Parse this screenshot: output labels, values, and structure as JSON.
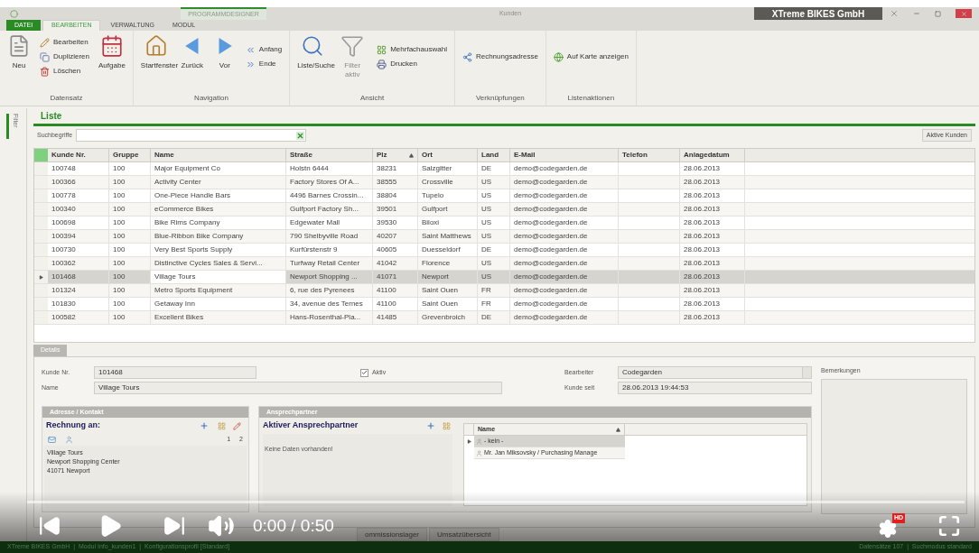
{
  "title_bar": {
    "contextual_tab": "PROGRAMMDESIGNER",
    "title": "Kunden",
    "company": "XTreme BIKES GmbH"
  },
  "ribbon_tabs": [
    {
      "label": "DATEI",
      "kind": "file",
      "selected": false
    },
    {
      "label": "BEARBEITEN",
      "kind": "tab",
      "selected": true
    },
    {
      "label": "VERWALTUNG",
      "kind": "tab",
      "selected": false
    },
    {
      "label": "MODUL",
      "kind": "tab",
      "selected": false
    }
  ],
  "ribbon_groups": [
    {
      "label": "Datensatz",
      "columns": [
        [
          {
            "label": "Neu",
            "kind": "large",
            "disabled": false
          }
        ],
        [
          {
            "label": "Bearbeiten",
            "kind": "small",
            "disabled": false
          },
          {
            "label": "Duplizieren",
            "kind": "small",
            "disabled": false
          },
          {
            "label": "Löschen",
            "kind": "small",
            "disabled": false
          }
        ],
        [
          {
            "label": "Aufgabe",
            "kind": "large",
            "disabled": false
          }
        ]
      ]
    },
    {
      "label": "Navigation",
      "columns": [
        [
          {
            "label": "Startfenster",
            "kind": "large",
            "disabled": false
          }
        ],
        [
          {
            "label": "Zurück",
            "kind": "large",
            "disabled": false
          }
        ],
        [
          {
            "label": "Vor",
            "kind": "large",
            "disabled": false
          }
        ],
        [
          {
            "label": "Anfang",
            "kind": "small",
            "disabled": false
          },
          {
            "label": "Ende",
            "kind": "small",
            "disabled": false
          }
        ]
      ]
    },
    {
      "label": "Ansicht",
      "columns": [
        [
          {
            "label": "Liste/Suche",
            "kind": "large",
            "disabled": false
          }
        ],
        [
          {
            "label": "Filter aktiv",
            "kind": "large",
            "disabled": true
          }
        ],
        [
          {
            "label": "Mehrfachauswahl",
            "kind": "small",
            "disabled": false
          },
          {
            "label": "Drucken",
            "kind": "small",
            "disabled": false
          }
        ]
      ]
    },
    {
      "label": "Verknüpfungen",
      "columns": [
        [
          {
            "label": "Rechnungsadresse",
            "kind": "small",
            "disabled": false
          }
        ]
      ]
    },
    {
      "label": "Listenaktionen",
      "columns": [
        [
          {
            "label": "Auf Karte anzeigen",
            "kind": "small",
            "disabled": false
          }
        ]
      ]
    }
  ],
  "side_panel": {
    "label": "Filter"
  },
  "list": {
    "title": "Liste",
    "search_label": "Suchbegriffe",
    "filter_button": "Aktive Kunden",
    "columns": [
      {
        "label": "Kunde Nr.",
        "sorted": false
      },
      {
        "label": "Gruppe",
        "sorted": false
      },
      {
        "label": "Name",
        "sorted": false
      },
      {
        "label": "Straße",
        "sorted": false
      },
      {
        "label": "Plz",
        "sorted": true
      },
      {
        "label": "Ort",
        "sorted": false
      },
      {
        "label": "Land",
        "sorted": false
      },
      {
        "label": "E-Mail",
        "sorted": false
      },
      {
        "label": "Telefon",
        "sorted": false
      },
      {
        "label": "Anlagedatum",
        "sorted": false
      }
    ],
    "rows": [
      {
        "selected": false,
        "cells": [
          "100748",
          "100",
          "Major Equipment Co",
          "Holstn 6444",
          "38231",
          "Salzgitter",
          "DE",
          "demo@codegarden.de",
          "",
          "28.06.2013"
        ]
      },
      {
        "selected": false,
        "cells": [
          "100366",
          "100",
          "Activity Center",
          "Factory Stores Of A...",
          "38555",
          "Crossville",
          "US",
          "demo@codegarden.de",
          "",
          "28.06.2013"
        ]
      },
      {
        "selected": false,
        "cells": [
          "100778",
          "100",
          "One-Piece Handle Bars",
          "4496 Barnes Crossin...",
          "38804",
          "Tupelo",
          "US",
          "demo@codegarden.de",
          "",
          "28.06.2013"
        ]
      },
      {
        "selected": false,
        "cells": [
          "100340",
          "100",
          "eCommerce Bikes",
          "Gulfport Factory Sh...",
          "39501",
          "Gulfport",
          "US",
          "demo@codegarden.de",
          "",
          "28.06.2013"
        ]
      },
      {
        "selected": false,
        "cells": [
          "100698",
          "100",
          "Bike Rims Company",
          "Edgewater Mall",
          "39530",
          "Biloxi",
          "US",
          "demo@codegarden.de",
          "",
          "28.06.2013"
        ]
      },
      {
        "selected": false,
        "cells": [
          "100394",
          "100",
          "Blue-Ribbon Bike Company",
          "790 Shelbyville Road",
          "40207",
          "Saint Matthews",
          "US",
          "demo@codegarden.de",
          "",
          "28.06.2013"
        ]
      },
      {
        "selected": false,
        "cells": [
          "100730",
          "100",
          "Very Best Sports Supply",
          "Kurfürstenstr 9",
          "40605",
          "Duesseldorf",
          "DE",
          "demo@codegarden.de",
          "",
          "28.06.2013"
        ]
      },
      {
        "selected": false,
        "cells": [
          "100362",
          "100",
          "Distinctive Cycles Sales & Servi...",
          "Turfway Retail Center",
          "41042",
          "Florence",
          "US",
          "demo@codegarden.de",
          "",
          "28.06.2013"
        ]
      },
      {
        "selected": true,
        "cells": [
          "101468",
          "100",
          "Village Tours",
          "Newport Shopping ...",
          "41071",
          "Newport",
          "US",
          "demo@codegarden.de",
          "",
          "28.06.2013"
        ]
      },
      {
        "selected": false,
        "cells": [
          "101324",
          "100",
          "Metro Sports Equipment",
          "6, rue des Pyrenees",
          "41100",
          "Saint Ouen",
          "FR",
          "demo@codegarden.de",
          "",
          "28.06.2013"
        ]
      },
      {
        "selected": false,
        "cells": [
          "101830",
          "100",
          "Getaway Inn",
          "34, avenue des Ternes",
          "41100",
          "Saint Ouen",
          "FR",
          "demo@codegarden.de",
          "",
          "28.06.2013"
        ]
      },
      {
        "selected": false,
        "cells": [
          "100582",
          "100",
          "Excellent Bikes",
          "Hans-Rosenthal-Pla...",
          "41485",
          "Grevenbroich",
          "DE",
          "demo@codegarden.de",
          "",
          "28.06.2013"
        ]
      }
    ]
  },
  "details": {
    "tab": "Details",
    "customer_no_label": "Kunde Nr.",
    "customer_no": "101468",
    "active_label": "Aktiv",
    "active_checked": true,
    "name_label": "Name",
    "name": "Village Tours",
    "editor_label": "Bearbeiter",
    "editor": "Codegarden",
    "since_label": "Kunde seit",
    "since": "28.06.2013 19:44:53",
    "remarks_label": "Bemerkungen"
  },
  "address_panel": {
    "header": "Adresse / Kontakt",
    "title": "Rechnung an:",
    "pages": [
      "1",
      "2"
    ],
    "lines": [
      "Village Tours",
      "Newport Shopping Center",
      "41071 Newport"
    ]
  },
  "contacts_panel": {
    "header": "Ansprechpartner",
    "title": "Aktiver Ansprechpartner",
    "empty_text": "Keine Daten vorhanden!",
    "grid_column": "Name",
    "grid_sorted": true,
    "grid_rows": [
      {
        "label": "- kein -",
        "selected": true
      },
      {
        "label": "Mr. Jan Miksovsky / Purchasing Manage",
        "selected": false
      }
    ]
  },
  "bottom_tabs": [
    {
      "label": "ommissionslager"
    },
    {
      "label": "Umsatzübersicht"
    }
  ],
  "status_bar": {
    "left": "XTreme BIKES GmbH  |  Modul Info_kunden1  |  Konfigurationsprofil [Standard]",
    "right": "Datensätze 107  |  Suchmodus standard"
  },
  "player": {
    "time": "0:00 / 0:50",
    "hd_badge": "HD",
    "progress": {
      "level": 0
    }
  }
}
